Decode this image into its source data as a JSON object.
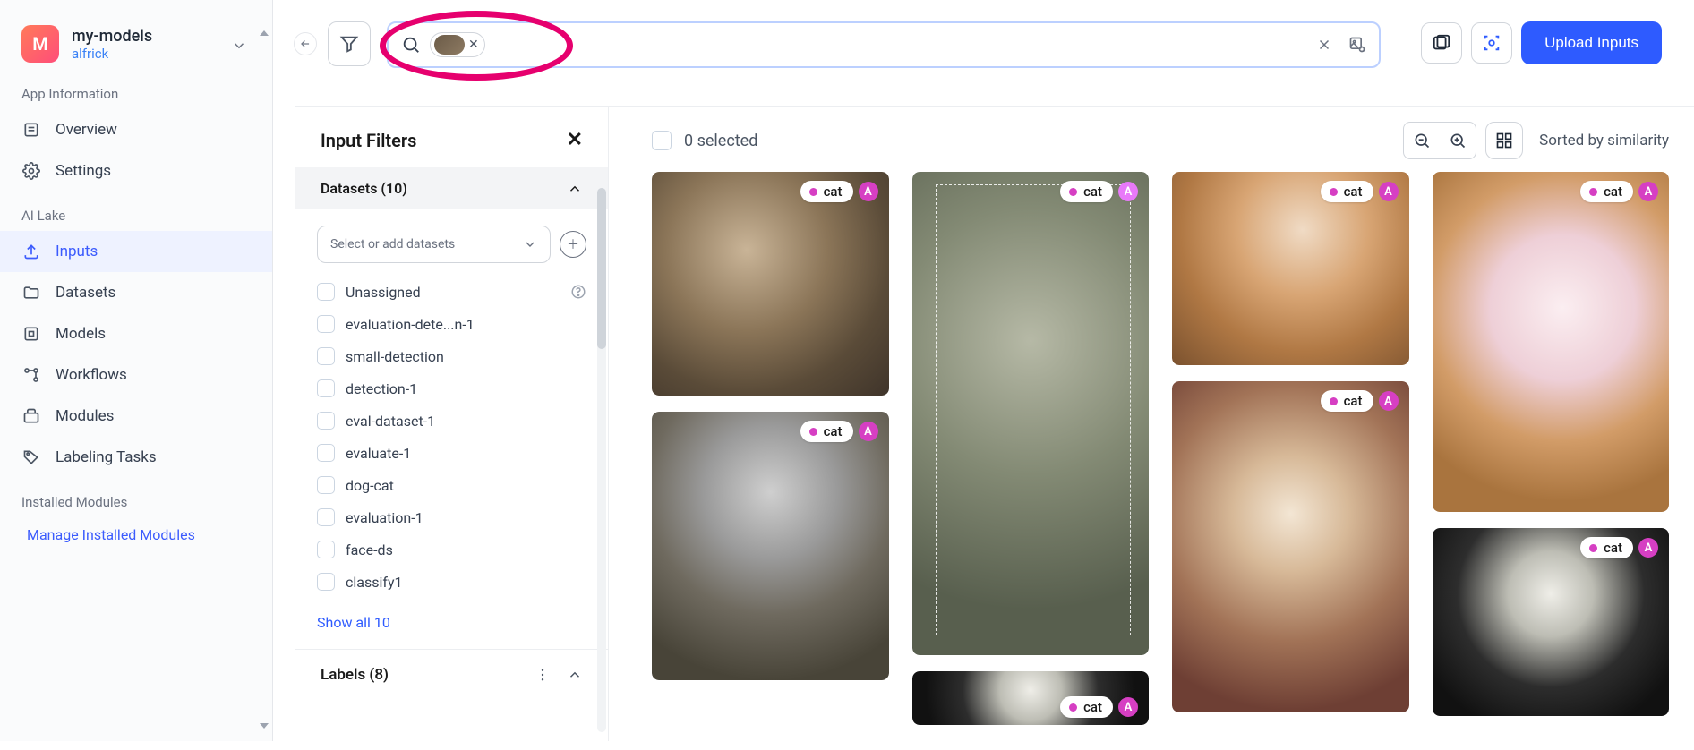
{
  "app": {
    "logo_letter": "M",
    "title": "my-models",
    "user": "alfrick"
  },
  "sidebar": {
    "section_app_info": "App Information",
    "items_app": [
      {
        "icon": "overview-icon",
        "label": "Overview"
      },
      {
        "icon": "settings-icon",
        "label": "Settings"
      }
    ],
    "section_lake": "AI Lake",
    "items_lake": [
      {
        "icon": "inputs-icon",
        "label": "Inputs",
        "active": true
      },
      {
        "icon": "datasets-icon",
        "label": "Datasets"
      },
      {
        "icon": "models-icon",
        "label": "Models"
      },
      {
        "icon": "workflows-icon",
        "label": "Workflows"
      },
      {
        "icon": "modules-icon",
        "label": "Modules"
      },
      {
        "icon": "labeling-icon",
        "label": "Labeling Tasks"
      }
    ],
    "section_installed": "Installed Modules",
    "manage_link": "Manage Installed Modules"
  },
  "topbar": {
    "upload_label": "Upload Inputs"
  },
  "filters": {
    "title": "Input Filters",
    "datasets_header": "Datasets (10)",
    "select_placeholder": "Select or add datasets",
    "items": [
      "Unassigned",
      "evaluation-dete...n-1",
      "small-detection",
      "detection-1",
      "eval-dataset-1",
      "evaluate-1",
      "dog-cat",
      "evaluation-1",
      "face-ds",
      "classify1"
    ],
    "show_all": "Show all 10",
    "labels_header": "Labels (8)"
  },
  "results": {
    "selected_text": "0 selected",
    "sort_text": "Sorted by similarity",
    "tag_label": "cat",
    "tag_badge": "A"
  }
}
